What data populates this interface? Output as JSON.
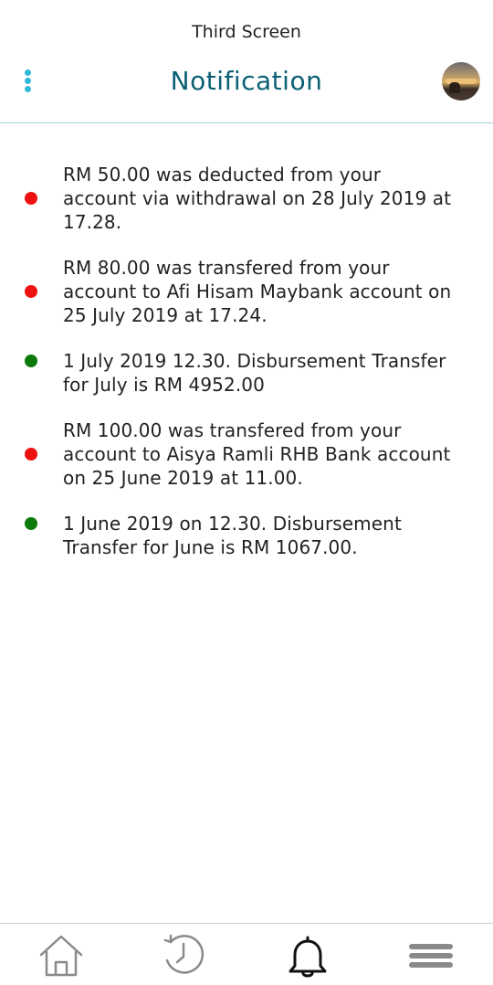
{
  "screen_label": "Third Screen",
  "header": {
    "title": "Notification",
    "menu_icon": "kebab-menu-icon",
    "avatar": "profile-avatar"
  },
  "colors": {
    "accent": "#2fb8d8",
    "title": "#0b5f74",
    "debit_dot": "#ee1111",
    "credit_dot": "#0b7a0b"
  },
  "notifications": [
    {
      "type": "debit",
      "text": "RM 50.00 was deducted from your account via withdrawal on 28 July 2019 at 17.28."
    },
    {
      "type": "debit",
      "text": "RM 80.00 was transfered from your account to Afi Hisam Maybank account on 25 July 2019 at 17.24."
    },
    {
      "type": "credit",
      "text": "1 July 2019 12.30. Disbursement Transfer for July is RM 4952.00"
    },
    {
      "type": "debit",
      "text": "RM 100.00 was transfered from your account to Aisya Ramli RHB Bank account on 25 June 2019 at 11.00."
    },
    {
      "type": "credit",
      "text": "1 June 2019 on 12.30. Disbursement Transfer for June is RM 1067.00."
    }
  ],
  "bottom_nav": {
    "items": [
      {
        "icon": "home-icon",
        "active": false
      },
      {
        "icon": "history-icon",
        "active": false
      },
      {
        "icon": "bell-icon",
        "active": true
      },
      {
        "icon": "hamburger-menu-icon",
        "active": false
      }
    ]
  }
}
